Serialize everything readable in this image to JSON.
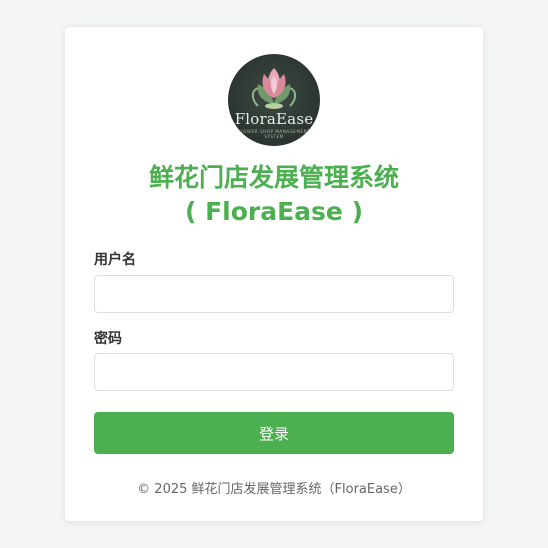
{
  "logo": {
    "brand_text": "FloraEase",
    "subtitle": "FLOWER SHOP MANAGEMENT SYSTEM"
  },
  "header": {
    "title_line1": "鲜花门店发展管理系统",
    "title_line2": "( FloraEase )"
  },
  "form": {
    "username_label": "用户名",
    "username_value": "",
    "password_label": "密码",
    "password_value": "",
    "login_label": "登录"
  },
  "footer": {
    "text": "© 2025 鲜花门店发展管理系统（FloraEase）"
  },
  "colors": {
    "accent": "#4caf50",
    "background": "#f4f5f7",
    "card": "#ffffff"
  }
}
